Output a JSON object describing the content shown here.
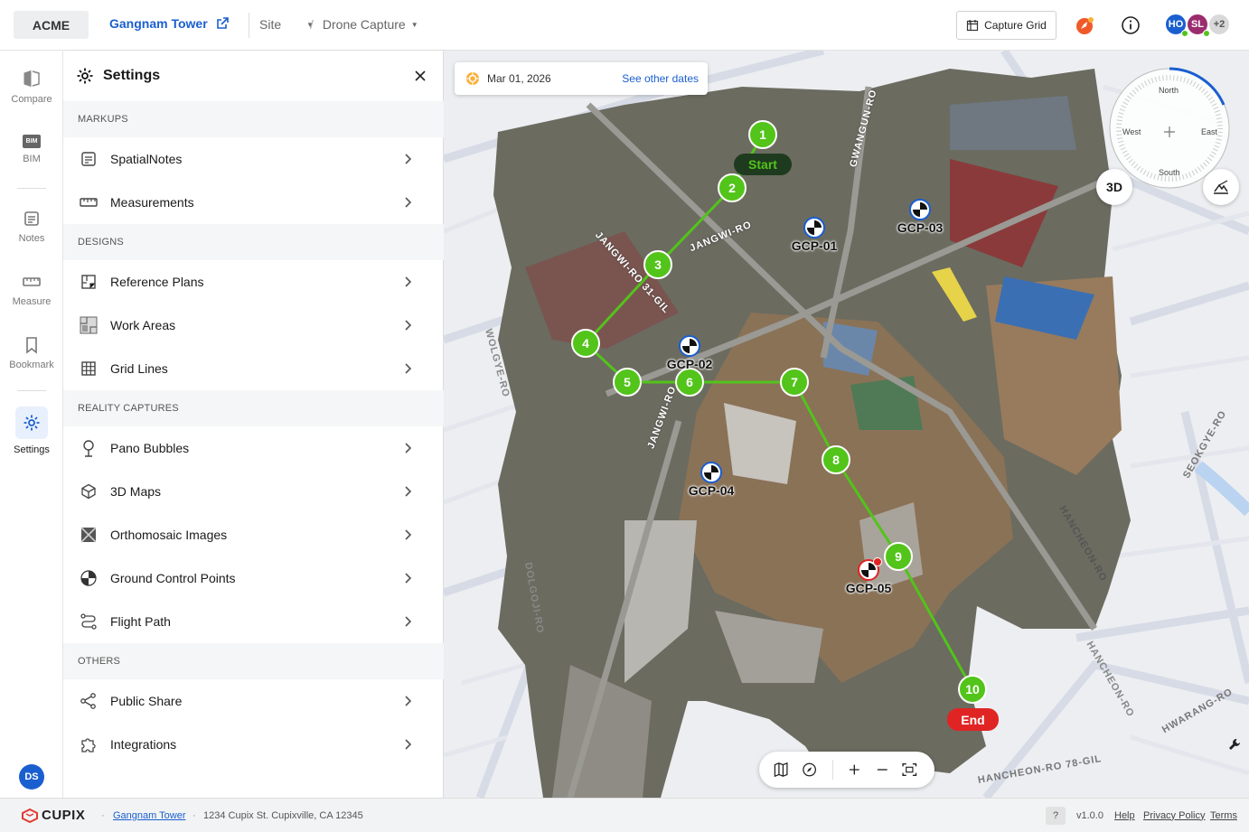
{
  "header": {
    "org": "ACME",
    "project": "Gangnam Tower",
    "site_label": "Site",
    "capture_label": "Drone Capture",
    "capture_grid": "Capture Grid",
    "avatars": [
      {
        "initials": "HO",
        "color": "#1a5fd0"
      },
      {
        "initials": "SL",
        "color": "#9b2d6e"
      }
    ],
    "more_users": "+2"
  },
  "rail": {
    "items": [
      {
        "label": "Compare"
      },
      {
        "label": "BIM"
      },
      {
        "label": "Notes"
      },
      {
        "label": "Measure"
      },
      {
        "label": "Bookmark"
      },
      {
        "label": "Settings"
      }
    ],
    "user_initials": "DS"
  },
  "settings": {
    "title": "Settings",
    "sections": [
      {
        "title": "MARKUPS",
        "items": [
          "SpatialNotes",
          "Measurements"
        ]
      },
      {
        "title": "DESIGNS",
        "items": [
          "Reference Plans",
          "Work Areas",
          "Grid Lines"
        ]
      },
      {
        "title": "REALITY CAPTURES",
        "items": [
          "Pano Bubbles",
          "3D Maps",
          "Orthomosaic Images",
          "Ground Control Points",
          "Flight Path"
        ]
      },
      {
        "title": "OTHERS",
        "items": [
          "Public Share",
          "Integrations"
        ]
      }
    ]
  },
  "map": {
    "date": "Mar 01, 2026",
    "other_dates": "See other dates",
    "compass": {
      "north": "North",
      "south": "South",
      "east": "East",
      "west": "West"
    },
    "btn_3d": "3D",
    "start_label": "Start",
    "end_label": "End",
    "waypoints": [
      "1",
      "2",
      "3",
      "4",
      "5",
      "6",
      "7",
      "8",
      "9",
      "10"
    ],
    "gcps": [
      "GCP-01",
      "GCP-02",
      "GCP-03",
      "GCP-04",
      "GCP-05"
    ],
    "street_labels": [
      "JANGWI-RO",
      "JANGWI-RO 31-GIL",
      "GWANGUN-RO",
      "HANCHEON-RO",
      "SEOKGYE-RO",
      "HWARANG-RO",
      "JANGWI-RO",
      "HANCHEON-RO 78-GIL",
      "DOLGOJI-RO",
      "WOLGYE-RO",
      "HANCHEON-RO"
    ],
    "colors": {
      "path": "#52c41a",
      "start_bg": "#1f3b1f",
      "end_bg": "#e02424"
    }
  },
  "footer": {
    "brand": "CUPIX",
    "project": "Gangnam Tower",
    "address": "1234 Cupix St. Cupixville, CA 12345",
    "help_q": "?",
    "version": "v1.0.0",
    "help": "Help",
    "privacy": "Privacy Policy",
    "terms": "Terms"
  }
}
